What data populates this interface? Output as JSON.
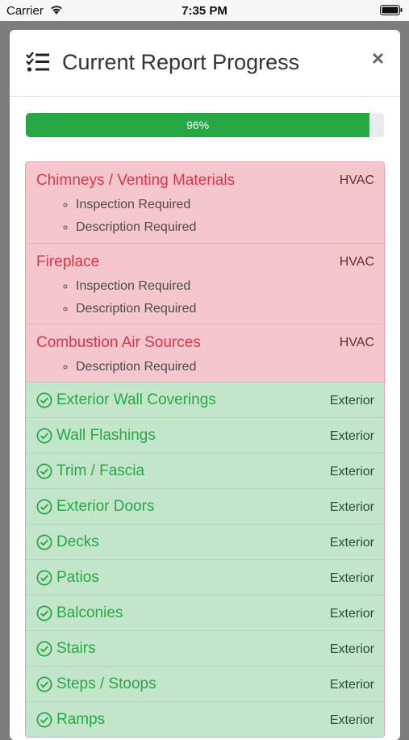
{
  "status_bar": {
    "carrier": "Carrier",
    "time": "7:35 PM"
  },
  "modal": {
    "title": "Current Report Progress",
    "close": "×"
  },
  "progress": {
    "value": 96,
    "label": "96%"
  },
  "colors": {
    "fail_bg": "#f5c6cb",
    "fail_text": "#dc3545",
    "pass_bg": "#c3e6cb",
    "pass_text": "#28a745"
  },
  "items": [
    {
      "status": "fail",
      "name": "Chimneys / Venting Materials",
      "category": "HVAC",
      "issues": [
        "Inspection Required",
        "Description Required"
      ]
    },
    {
      "status": "fail",
      "name": "Fireplace",
      "category": "HVAC",
      "issues": [
        "Inspection Required",
        "Description Required"
      ]
    },
    {
      "status": "fail",
      "name": "Combustion Air Sources",
      "category": "HVAC",
      "issues": [
        "Description Required"
      ]
    },
    {
      "status": "pass",
      "name": "Exterior Wall Coverings",
      "category": "Exterior"
    },
    {
      "status": "pass",
      "name": "Wall Flashings",
      "category": "Exterior"
    },
    {
      "status": "pass",
      "name": "Trim / Fascia",
      "category": "Exterior"
    },
    {
      "status": "pass",
      "name": "Exterior Doors",
      "category": "Exterior"
    },
    {
      "status": "pass",
      "name": "Decks",
      "category": "Exterior"
    },
    {
      "status": "pass",
      "name": "Patios",
      "category": "Exterior"
    },
    {
      "status": "pass",
      "name": "Balconies",
      "category": "Exterior"
    },
    {
      "status": "pass",
      "name": "Stairs",
      "category": "Exterior"
    },
    {
      "status": "pass",
      "name": "Steps / Stoops",
      "category": "Exterior"
    },
    {
      "status": "pass",
      "name": "Ramps",
      "category": "Exterior"
    }
  ]
}
